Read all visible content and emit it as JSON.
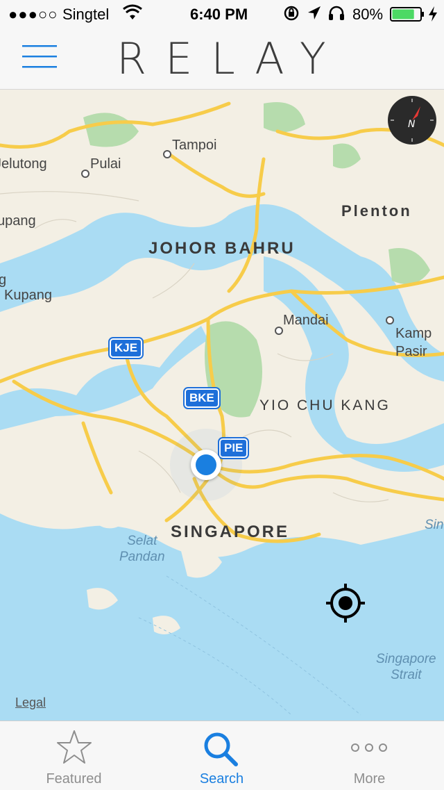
{
  "status_bar": {
    "signal": "●●●○○",
    "carrier": "Singtel",
    "time": "6:40 PM",
    "battery_percent": "80%",
    "battery_level": 0.8
  },
  "header": {
    "title": "RELAY"
  },
  "map": {
    "labels": {
      "jelutong": "Jelutong",
      "pulai": "Pulai",
      "tampoi": "Tampoi",
      "plentong": "Plenton",
      "kupang_top": "upang",
      "johor_bahru": "Johor Bahru",
      "kupang": "Kupang",
      "g": "g",
      "mandai": "Mandai",
      "kampong_pasir": "Kamp\nPasir",
      "yio_chu_kang": "Yio Chu Kang",
      "singapore": "Singapore",
      "selat_pandan": "Selat\nPandan",
      "singapore_strait": "Singapore\nStrait",
      "sin": "Sin"
    },
    "shields": {
      "kje": "KJE",
      "bke": "BKE",
      "pie": "PIE"
    },
    "legal": "Legal"
  },
  "tabs": [
    {
      "label": "Featured",
      "icon": "star-icon"
    },
    {
      "label": "Search",
      "icon": "search-icon"
    },
    {
      "label": "More",
      "icon": "more-icon"
    }
  ],
  "colors": {
    "accent": "#1a7fe0",
    "water": "#aadcf3",
    "land": "#f3efe4",
    "park": "#b6dcad",
    "road": "#f7cc4a"
  }
}
